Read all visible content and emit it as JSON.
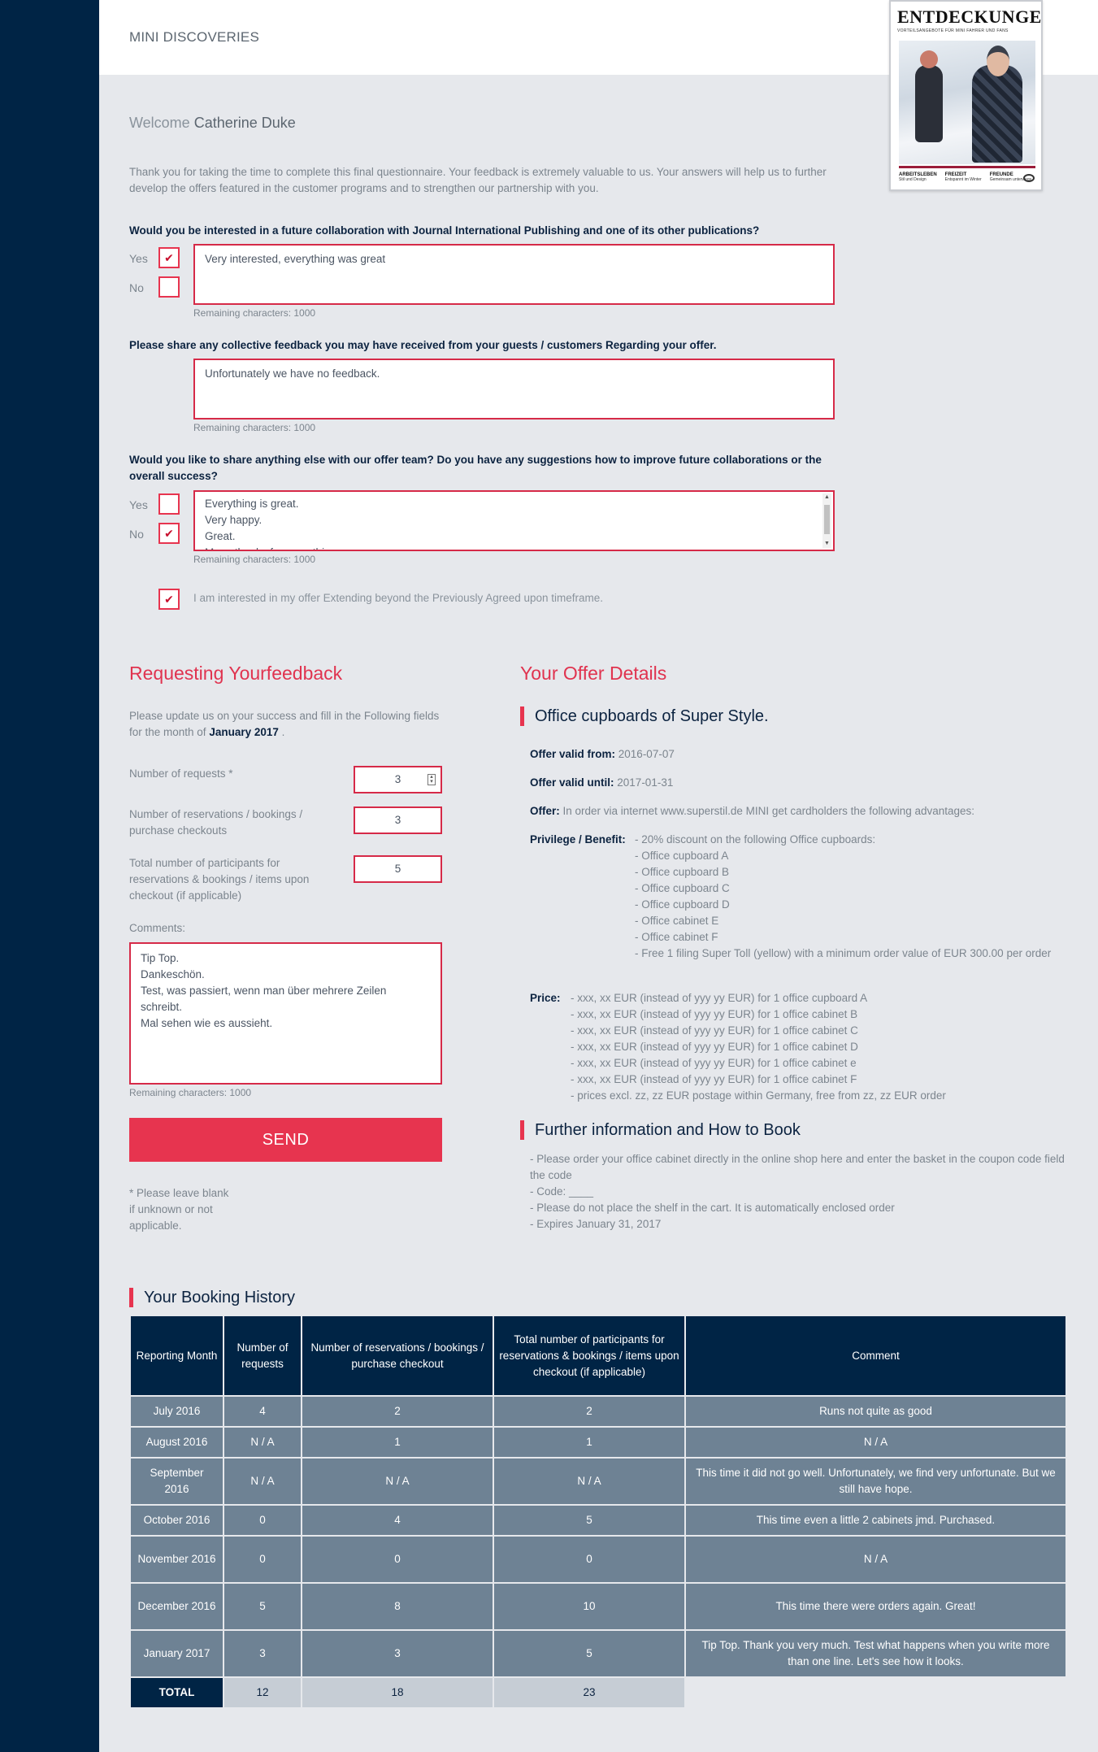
{
  "brand": "MINI DISCOVERIES",
  "magazine": {
    "title": "ENTDECKUNGEN",
    "subtitle": "VORTEILSANGEBOTE FÜR MINI FAHRER UND FANS",
    "foot": [
      {
        "head": "ARBEITSLEBEN",
        "text": "Stil und Design"
      },
      {
        "head": "FREIZEIT",
        "text": "Entspannt im Winter"
      },
      {
        "head": "FREUNDE",
        "text": "Gemeinsam unterwegs"
      }
    ]
  },
  "welcome": {
    "label": "Welcome",
    "name": "Catherine Duke"
  },
  "intro": "Thank you for taking the time to complete this final questionnaire. Your feedback is extremely valuable to us. Your answers will help us to further develop the offers featured in the customer programs and to strengthen our partnership with you.",
  "questions": {
    "q1": {
      "text": "Would you be interested in a future collaboration with Journal International Publishing and one of its other publications?",
      "yes_label": "Yes",
      "no_label": "No",
      "yes_checked": "✔",
      "no_checked": "",
      "answer": "Very interested, everything was great",
      "remaining": "Remaining characters: 1000"
    },
    "q2": {
      "text": "Please share any collective feedback you may have received from your guests / customers Regarding your offer.",
      "answer": "Unfortunately we have no feedback.",
      "remaining": "Remaining characters: 1000"
    },
    "q3": {
      "text": "Would you like to share anything else with our offer team? Do you have any suggestions how to improve future collaborations or the overall success?",
      "yes_label": "Yes",
      "no_label": "No",
      "yes_checked": "",
      "no_checked": "✔",
      "answer_lines": [
        "Everything is great.",
        "Very happy.",
        "Great.",
        "Many thanks for everything"
      ],
      "remaining": "Remaining characters: 1000"
    },
    "extend": {
      "checked": "✔",
      "text": "I am interested in my offer Extending beyond the Previously Agreed upon timeframe."
    }
  },
  "request": {
    "title": "Requesting Yourfeedback",
    "intro_pre": "Please update us on your success and fill in the Following fields for the month of",
    "intro_month": "January 2017",
    "intro_post": ".",
    "fields": {
      "requests": {
        "label": "Number of requests *",
        "value": "3"
      },
      "reservations": {
        "label": "Number of reservations / bookings / purchase checkouts",
        "value": "3"
      },
      "participants": {
        "label": "Total number of participants for reservations & bookings / items upon checkout (if applicable)",
        "value": "5"
      }
    },
    "comments_label": "Comments:",
    "comments": "Tip Top.\nDankeschön.\nTest, was passiert, wenn man über mehrere Zeilen schreibt.\nMal sehen wie es aussieht.",
    "remaining": "Remaining characters: 1000",
    "send_label": "SEND",
    "note": "* Please leave blank if unknown or not applicable."
  },
  "offer": {
    "title": "Your Offer Details",
    "name": "Office cupboards of Super Style.",
    "valid_from_label": "Offer valid from:",
    "valid_from": "2016-07-07",
    "valid_until_label": "Offer valid until:",
    "valid_until": "2017-01-31",
    "offer_label": "Offer:",
    "offer_text": "In order via internet www.superstil.de MINI get cardholders the following advantages:",
    "benefit_label": "Privilege / Benefit:",
    "benefits": [
      "- 20% discount on the following Office cupboards:",
      "- Office cupboard A",
      "- Office cupboard B",
      "- Office cupboard C",
      "- Office cupboard D",
      "- Office cabinet E",
      "- Office cabinet F",
      "- Free 1 filing Super Toll (yellow) with a minimum order value of EUR 300.00 per order"
    ],
    "price_label": "Price:",
    "prices": [
      "- xxx, xx EUR (instead of yyy yy EUR) for 1 office cupboard A",
      "- xxx, xx EUR (instead of yyy yy EUR) for 1 office cabinet B",
      "- xxx, xx EUR (instead of yyy yy EUR) for 1 office cabinet C",
      "- xxx, xx EUR (instead of yyy yy EUR) for 1 office cabinet D",
      "- xxx, xx EUR (instead of yyy yy EUR) for 1 office cabinet e",
      "- xxx, xx EUR (instead of yyy yy EUR) for 1 office cabinet F",
      "- prices excl. zz, zz EUR postage within Germany, free from zz, zz EUR order"
    ],
    "further_title": "Further information and How to Book",
    "further": [
      "- Please order your office cabinet directly in the online shop here and enter the basket in the coupon code field the code",
      "- Code: ____",
      "- Please do not place the shelf in the cart. It is automatically enclosed order",
      "- Expires January 31, 2017"
    ]
  },
  "history": {
    "title": "Your Booking History",
    "headers": [
      "Reporting Month",
      "Number of requests",
      "Number of reservations / bookings / purchase checkout",
      "Total number of participants for reservations & bookings / items upon checkout (if applicable)",
      "Comment"
    ],
    "rows": [
      [
        "July 2016",
        "4",
        "2",
        "2",
        "Runs not quite as good"
      ],
      [
        "August 2016",
        "N / A",
        "1",
        "1",
        "N / A"
      ],
      [
        "September 2016",
        "N / A",
        "N / A",
        "N / A",
        "This time it did not go well. Unfortunately, we find very unfortunate. But we still have hope."
      ],
      [
        "October 2016",
        "0",
        "4",
        "5",
        "This time even a little 2 cabinets jmd. Purchased."
      ],
      [
        "November 2016",
        "0",
        "0",
        "0",
        "N / A"
      ],
      [
        "December 2016",
        "5",
        "8",
        "10",
        "This time there were orders again. Great!"
      ],
      [
        "January 2017",
        "3",
        "3",
        "5",
        "Tip Top. Thank you very much. Test what happens when you write more than one line. Let's see how it looks."
      ]
    ],
    "total": [
      "TOTAL",
      "12",
      "18",
      "23"
    ]
  },
  "colors": {
    "accent": "#e7344f",
    "navy": "#002445",
    "row": "#6e8294",
    "background": "#e6e8ec"
  }
}
